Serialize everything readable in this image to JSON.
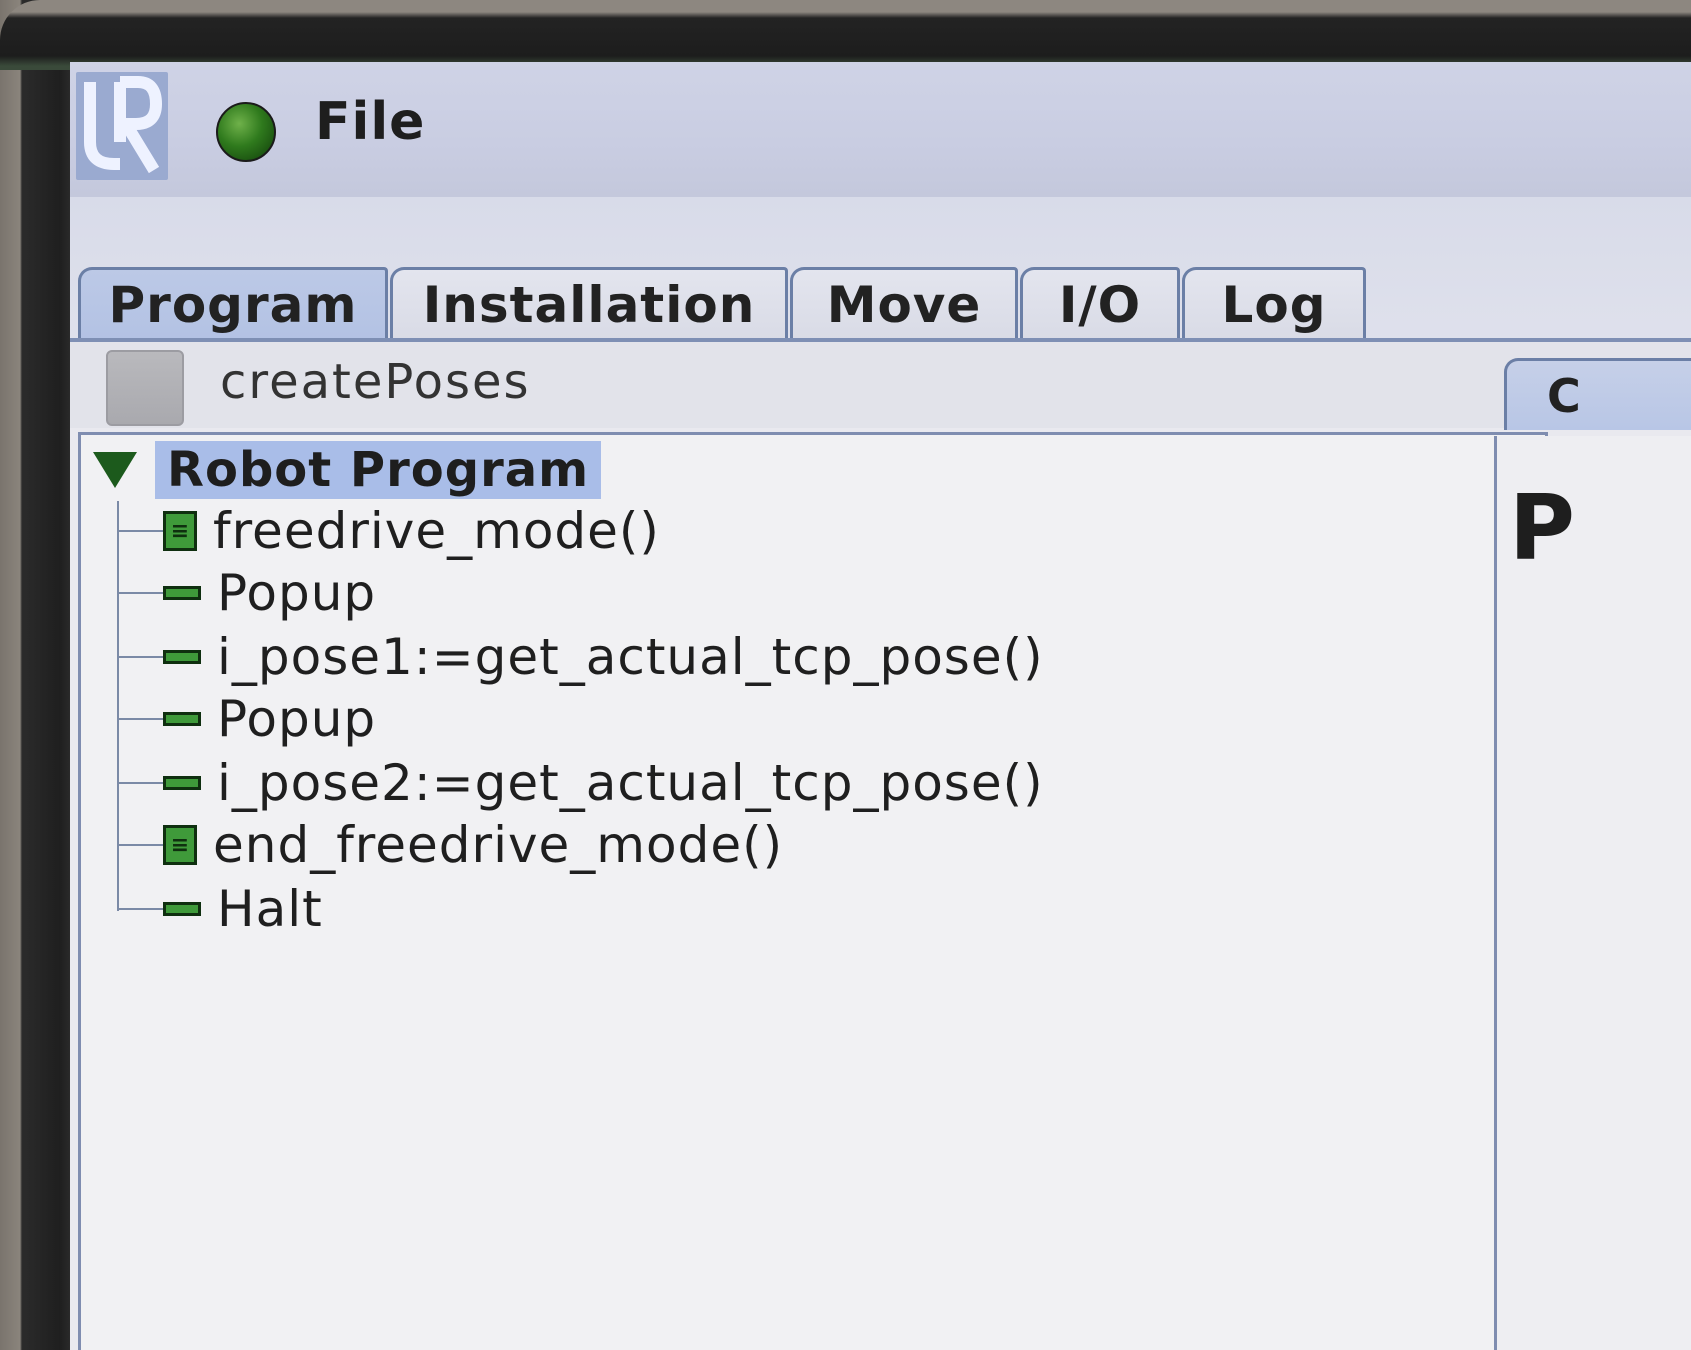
{
  "header": {
    "menu_label": "File"
  },
  "tabs": [
    {
      "label": "Program",
      "active": true
    },
    {
      "label": "Installation",
      "active": false
    },
    {
      "label": "Move",
      "active": false
    },
    {
      "label": "I/O",
      "active": false
    },
    {
      "label": "Log",
      "active": false
    }
  ],
  "program": {
    "name": "createPoses"
  },
  "tree": {
    "root": "Robot Program",
    "items": [
      {
        "label": "freedrive_mode()",
        "icon": "script-icon"
      },
      {
        "label": "Popup",
        "icon": "command-icon"
      },
      {
        "label": "i_pose1:=get_actual_tcp_pose()",
        "icon": "command-icon"
      },
      {
        "label": "Popup",
        "icon": "command-icon"
      },
      {
        "label": "i_pose2:=get_actual_tcp_pose()",
        "icon": "command-icon"
      },
      {
        "label": "end_freedrive_mode()",
        "icon": "script-icon"
      },
      {
        "label": "Halt",
        "icon": "command-icon"
      }
    ]
  },
  "right_panel": {
    "tab_label": "C",
    "heading": "P"
  },
  "colors": {
    "status_ok": "#2f7a1d",
    "selection": "#a9bde8",
    "node_icon": "#3f9a3a"
  }
}
